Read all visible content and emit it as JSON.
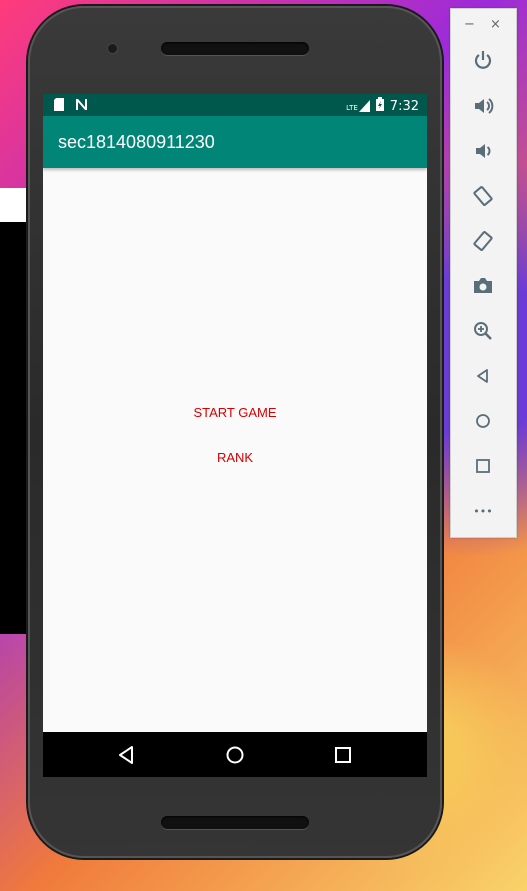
{
  "app": {
    "title": "sec1814080911230"
  },
  "status_bar": {
    "time": "7:32",
    "network": "LTE"
  },
  "main": {
    "start_label": "START GAME",
    "rank_label": "RANK"
  },
  "colors": {
    "status_bar": "#00574b",
    "app_bar": "#008577",
    "button_text": "#d50000",
    "screen_bg": "#fafafa"
  },
  "emulator_toolbar": {
    "minimize": "−",
    "close": "×",
    "more": "•••",
    "icons": [
      "power-icon",
      "volume-up-icon",
      "volume-down-icon",
      "rotate-left-icon",
      "rotate-right-icon",
      "camera-icon",
      "zoom-icon",
      "back-icon",
      "home-icon",
      "overview-icon",
      "more-icon"
    ]
  }
}
